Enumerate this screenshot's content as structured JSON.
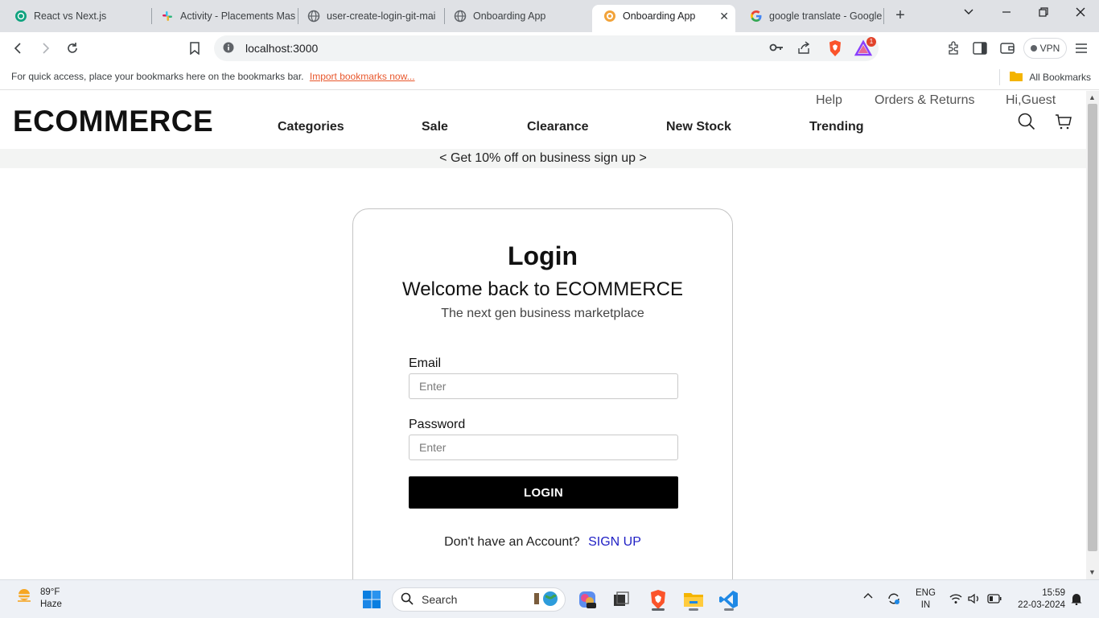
{
  "browser": {
    "tabs": [
      {
        "title": "React vs Next.js",
        "icon": "chatgpt-icon"
      },
      {
        "title": "Activity - Placements Mas",
        "icon": "slack-icon"
      },
      {
        "title": "user-create-login-git-mai",
        "icon": "globe-icon"
      },
      {
        "title": "Onboarding App",
        "icon": "globe-icon"
      },
      {
        "title": "Onboarding App",
        "icon": "onboarding-icon",
        "active": true
      },
      {
        "title": "google translate - Google",
        "icon": "google-icon"
      }
    ],
    "url": "localhost:3000",
    "vpn_label": "VPN",
    "rewards_badge": "1",
    "bookmarks_message": "For quick access, place your bookmarks here on the bookmarks bar.",
    "import_link": "Import bookmarks now...",
    "all_bookmarks": "All Bookmarks"
  },
  "site": {
    "brand": "ECOMMERCE",
    "top_links": [
      "Help",
      "Orders & Returns",
      "Hi,Guest"
    ],
    "nav": [
      "Categories",
      "Sale",
      "Clearance",
      "New Stock",
      "Trending"
    ],
    "promo": "< Get 10% off on business sign up >"
  },
  "login": {
    "title": "Login",
    "welcome": "Welcome back to ECOMMERCE",
    "subtitle": "The next gen business marketplace",
    "email_label": "Email",
    "email_placeholder": "Enter",
    "password_label": "Password",
    "password_placeholder": "Enter",
    "button": "LOGIN",
    "signup_prompt": "Don't have an Account?",
    "signup_link": "SIGN UP"
  },
  "taskbar": {
    "temperature": "89°F",
    "condition": "Haze",
    "search_placeholder": "Search",
    "language": "ENG",
    "region": "IN",
    "time": "15:59",
    "date": "22-03-2024"
  }
}
